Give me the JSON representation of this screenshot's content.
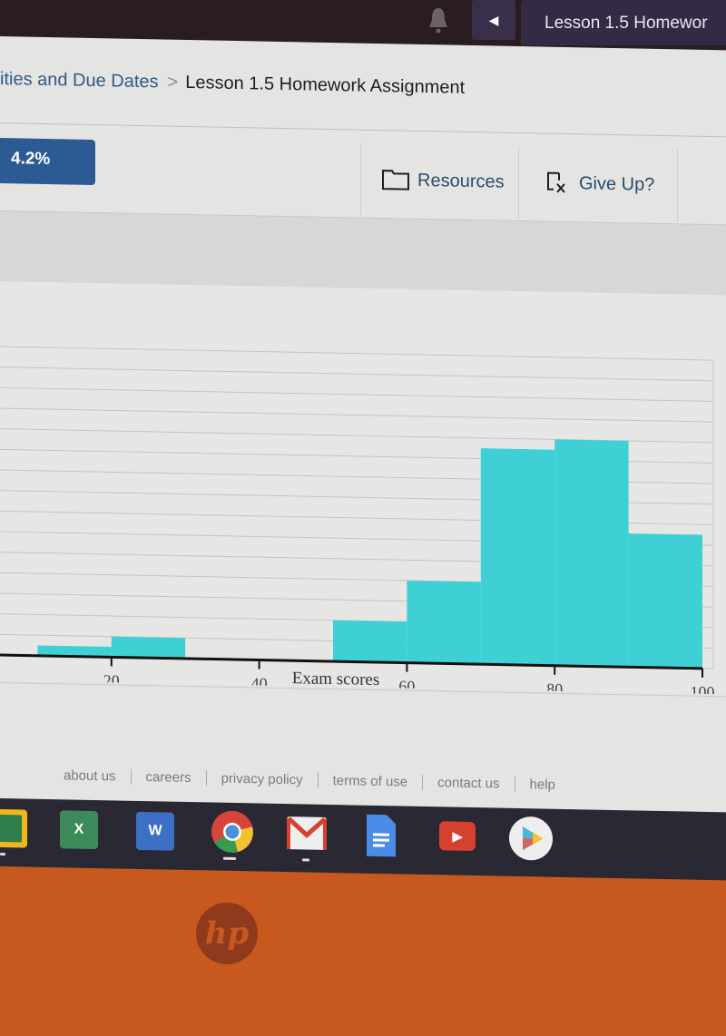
{
  "topbar": {
    "tab_title": "Lesson 1.5 Homewor",
    "back_glyph": "◀"
  },
  "breadcrumb": {
    "parent": "ities and Due Dates",
    "separator": ">",
    "current": "Lesson 1.5 Homework Assignment"
  },
  "toolbar": {
    "score": "4.2%",
    "resources_label": "Resources",
    "give_up_label": "Give Up?"
  },
  "colors": {
    "bar_fill": "#3fd0d6",
    "accent": "#2c5b93",
    "laptop_body": "#c8591e"
  },
  "chart_data": {
    "type": "bar",
    "subtype": "histogram",
    "title": "",
    "xlabel": "Exam scores",
    "ylabel": "",
    "bins": [
      {
        "from": 10,
        "to": 20,
        "value": 1
      },
      {
        "from": 20,
        "to": 30,
        "value": 2
      },
      {
        "from": 30,
        "to": 40,
        "value": 0
      },
      {
        "from": 40,
        "to": 50,
        "value": 0
      },
      {
        "from": 50,
        "to": 60,
        "value": 4
      },
      {
        "from": 60,
        "to": 70,
        "value": 8
      },
      {
        "from": 70,
        "to": 80,
        "value": 21
      },
      {
        "from": 80,
        "to": 90,
        "value": 22
      },
      {
        "from": 90,
        "to": 100,
        "value": 13
      }
    ],
    "x_ticks": [
      "20",
      "40",
      "60",
      "80",
      "100"
    ],
    "x_tick_values": [
      20,
      40,
      60,
      80,
      100
    ],
    "xlim": [
      0,
      100
    ],
    "ylim": [
      0,
      30
    ],
    "grid": true,
    "grid_step": 2
  },
  "footer": {
    "links": [
      "about us",
      "careers",
      "privacy policy",
      "terms of use",
      "contact us",
      "help"
    ]
  },
  "taskbar": {
    "apps": [
      {
        "name": "Google Classroom",
        "glyph": "",
        "color": "#f2b61d"
      },
      {
        "name": "Excel",
        "glyph": "X",
        "color": "#3d8a5a"
      },
      {
        "name": "Word",
        "glyph": "W",
        "color": "#3d6fc4"
      },
      {
        "name": "Chrome",
        "glyph": "",
        "color": "#d8443a"
      },
      {
        "name": "Gmail",
        "glyph": "M",
        "color": "#eeeeee"
      },
      {
        "name": "Docs",
        "glyph": "≡",
        "color": "#4a8de6"
      },
      {
        "name": "YouTube",
        "glyph": "▶",
        "color": "#d6412f"
      },
      {
        "name": "Play Store",
        "glyph": "▶",
        "color": "#eeeeee"
      }
    ]
  },
  "laptop": {
    "logo": "hp"
  }
}
